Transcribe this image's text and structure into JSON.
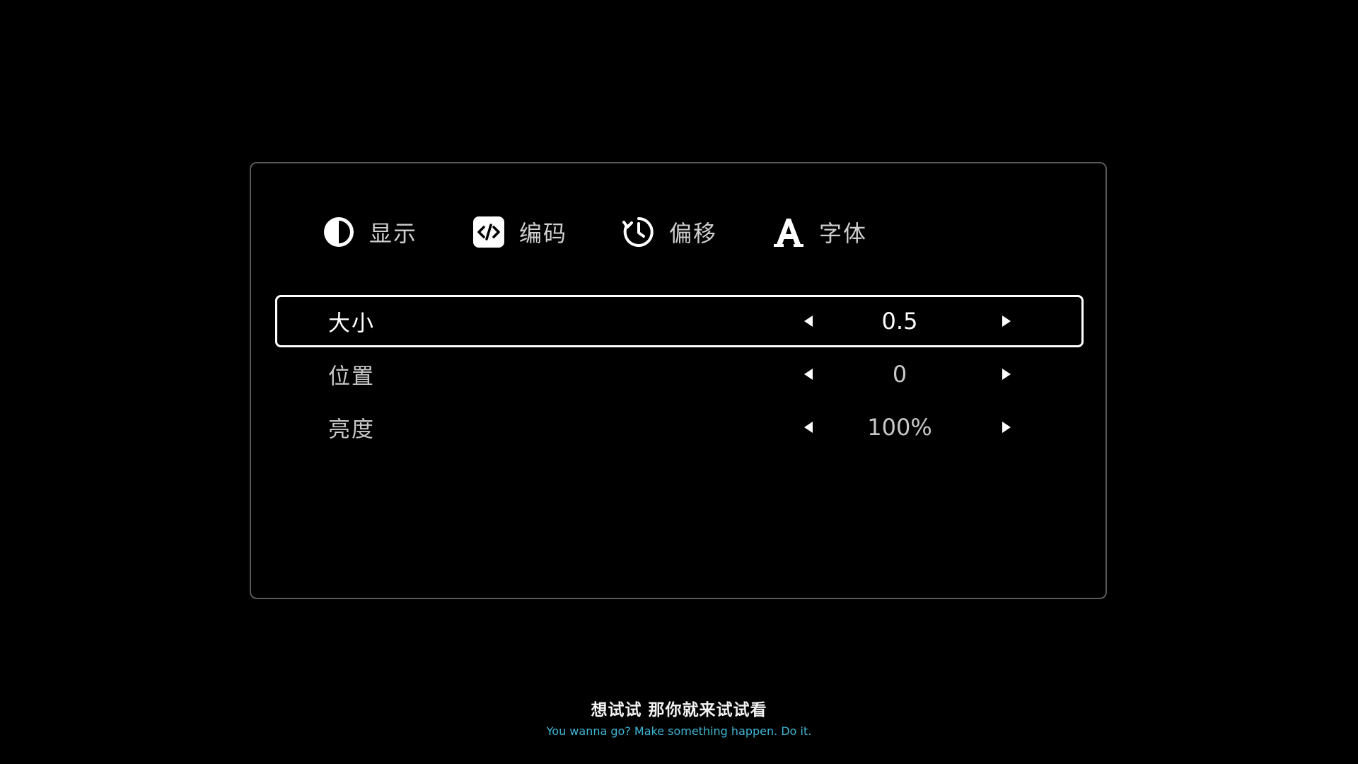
{
  "tabs": [
    {
      "label": "显示",
      "icon": "contrast-icon"
    },
    {
      "label": "编码",
      "icon": "code-icon"
    },
    {
      "label": "偏移",
      "icon": "timer-icon"
    },
    {
      "label": "字体",
      "icon": "font-icon"
    }
  ],
  "settings": [
    {
      "label": "大小",
      "value": "0.5",
      "selected": true
    },
    {
      "label": "位置",
      "value": "0",
      "selected": false
    },
    {
      "label": "亮度",
      "value": "100%",
      "selected": false
    }
  ],
  "subtitle": {
    "primary": "想试试 那你就来试试看",
    "secondary": "You wanna go? Make something happen. Do it."
  },
  "colors": {
    "background": "#000000",
    "panel_border": "#5a5a5a",
    "selected_border": "#ffffff",
    "subtitle_secondary": "#3fb6d6"
  }
}
